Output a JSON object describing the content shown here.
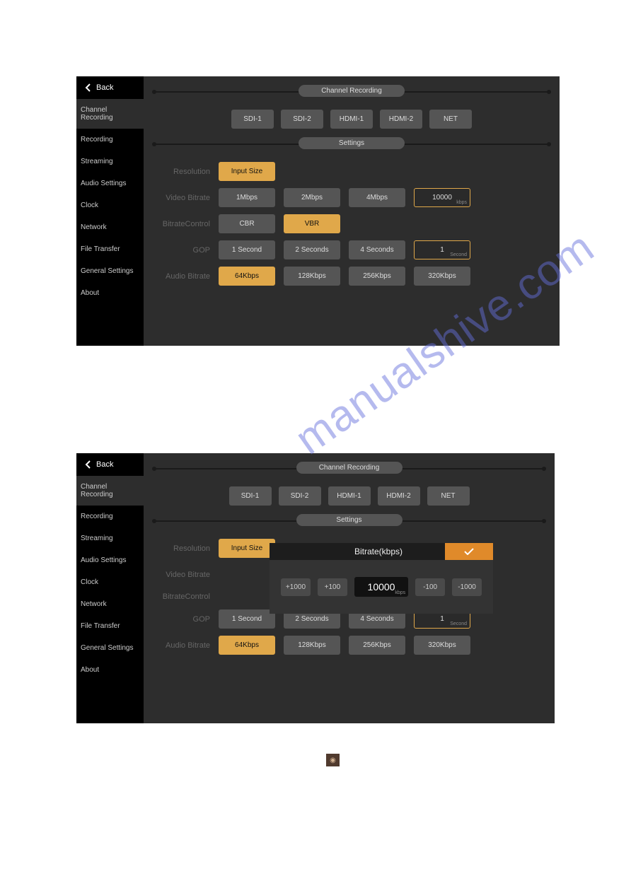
{
  "back_label": "Back",
  "sidebar": {
    "items": [
      "Channel Recording",
      "Recording",
      "Streaming",
      "Audio Settings",
      "Clock",
      "Network",
      "File Transfer",
      "General Settings",
      "About"
    ]
  },
  "sections": {
    "channel": "Channel Recording",
    "settings": "Settings"
  },
  "channels": [
    "SDI-1",
    "SDI-2",
    "HDMI-1",
    "HDMI-2",
    "NET"
  ],
  "rows": {
    "resolution": {
      "label": "Resolution",
      "options": [
        "Input Size"
      ],
      "selected": "Input Size"
    },
    "video_bitrate": {
      "label": "Video Bitrate",
      "options": [
        "1Mbps",
        "2Mbps",
        "4Mbps"
      ],
      "custom_value": "10000",
      "custom_unit": "kbps"
    },
    "bitrate_control": {
      "label": "BitrateControl",
      "options": [
        "CBR",
        "VBR"
      ],
      "selected": "VBR"
    },
    "gop": {
      "label": "GOP",
      "options": [
        "1 Second",
        "2 Seconds",
        "4 Seconds"
      ],
      "custom_value": "1",
      "custom_unit": "Second"
    },
    "audio_bitrate": {
      "label": "Audio Bitrate",
      "options": [
        "64Kbps",
        "128Kbps",
        "256Kbps",
        "320Kbps"
      ],
      "selected": "64Kbps"
    }
  },
  "modal": {
    "title": "Bitrate(kbps)",
    "value": "10000",
    "unit": "kbps",
    "steps_plus": [
      "+1000",
      "+100"
    ],
    "steps_minus": [
      "-100",
      "-1000"
    ]
  },
  "watermark": "manualshive.com"
}
